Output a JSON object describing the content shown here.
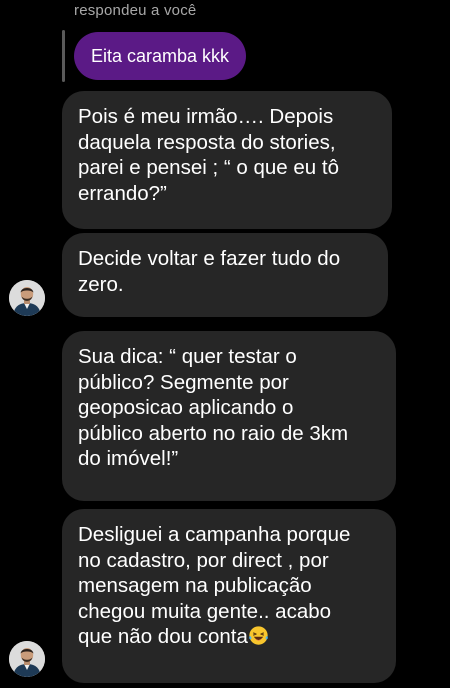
{
  "reply_context": {
    "header": "respondeu a você",
    "quoted_message": "Eita caramba kkk"
  },
  "messages": [
    {
      "text": "Pois é meu irmão…. Depois\ndaquela resposta do stories,\nparei e pensei ; “ o que eu tô\nerrando?”"
    },
    {
      "text": "Decide voltar e fazer tudo do\nzero."
    },
    {
      "text": "Sua dica: “ quer testar o\npúblico? Segmente por\ngeoposicao aplicando o\npúblico aberto no raio de 3km\ndo imóvel!”"
    },
    {
      "text": "Desliguei a campanha porque\nno cadastro, por direct , por\nmensagem na publicação\nchegou muita gente.. acabo\nque não dou conta",
      "trailing_emoji": "laughing-tears-emoji"
    }
  ],
  "colors": {
    "background": "#000000",
    "incoming_bubble": "#262626",
    "quoted_bubble": "#5b1a86",
    "muted_text": "#a8a8a8"
  }
}
